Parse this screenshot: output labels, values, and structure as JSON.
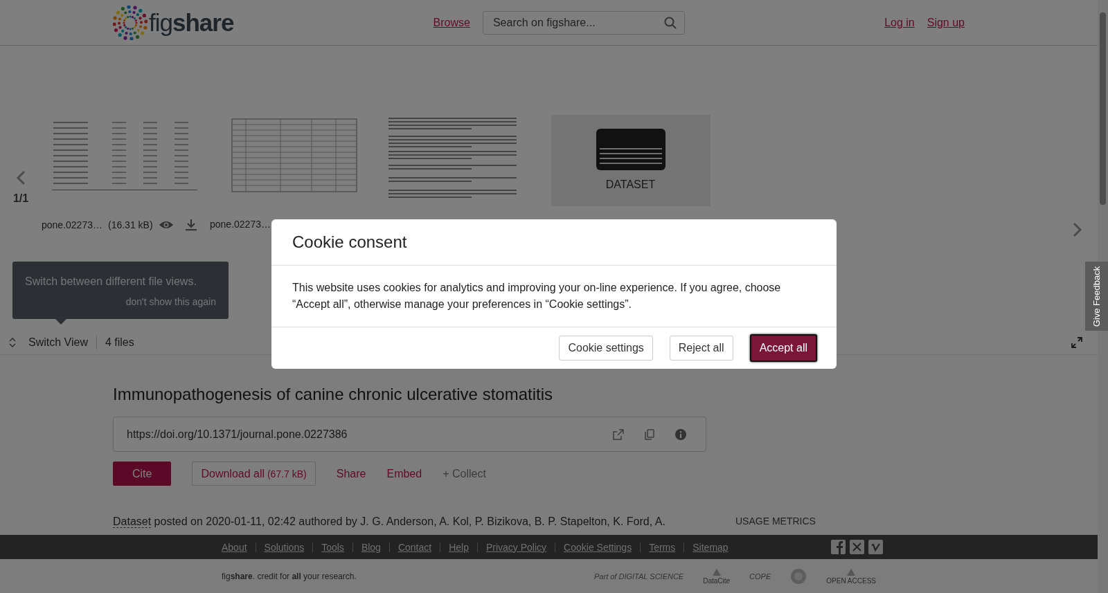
{
  "header": {
    "logo": "fig**share**",
    "nav_link": "Browse",
    "search": {
      "placeholder": "Search on figshare..."
    },
    "account_links": [
      "Log in",
      "Sign up"
    ]
  },
  "carousel": {
    "page_indicator": "1/1",
    "thumbnails": [
      {
        "kind": "table_doc"
      },
      {
        "kind": "table_grid"
      },
      {
        "kind": "text_doc"
      },
      {
        "kind": "dataset",
        "label": "DATASET"
      }
    ],
    "files": [
      {
        "name": "pone.02273…",
        "size": "(16.31 kB)"
      },
      {
        "name": "pone.02273…"
      }
    ]
  },
  "tooltip": {
    "text": "Switch between different file views.",
    "dismiss": "don't show this again"
  },
  "toolbar": {
    "switch_view": "Switch View",
    "file_count": "4 files"
  },
  "feedback_tab": "Give Feedback",
  "item": {
    "title": "Immunopathogenesis of canine chronic ulcerative stomatitis",
    "doi": "https://doi.org/10.1371/journal.pone.0227386",
    "actions": [
      {
        "kind": "primary",
        "label": "Cite"
      },
      {
        "kind": "outline",
        "label": "Download all",
        "size": "(67.7 kB)"
      },
      {
        "kind": "link",
        "label": "Share"
      },
      {
        "kind": "link",
        "label": "Embed"
      },
      {
        "kind": "muted",
        "label": "+ Collect"
      }
    ],
    "item_type": "Dataset",
    "meta": " posted on 2020-01-11, 02:42 authored by J. G. Anderson, A. Kol, P. Bizikova, B. P. Stapelton, K. Ford, A.",
    "usage_metrics": "USAGE METRICS"
  },
  "footer": {
    "links": [
      "About",
      "Solutions",
      "Tools",
      "Blog",
      "Contact",
      "Help",
      "Privacy Policy",
      "Cookie Settings",
      "Terms",
      "Sitemap"
    ],
    "tagline": "fig**share**. credit for **all** your research.",
    "partners": [
      {
        "kind": "text",
        "text": "Part of DIGITAL SCIENCE"
      },
      {
        "kind": "mark",
        "text": "DataCite"
      },
      {
        "kind": "text",
        "text": "COPE"
      },
      {
        "kind": "circle"
      },
      {
        "kind": "mark",
        "text": "OPEN ACCESS"
      }
    ]
  },
  "cookie_modal": {
    "title": "Cookie consent",
    "body": "This website uses cookies for analytics and improving your on-line experience. If you agree, choose “Accept all”, otherwise manage your preferences in “Cookie settings”.",
    "buttons": [
      {
        "kind": "secondary",
        "label": "Cookie settings"
      },
      {
        "kind": "secondary",
        "label": "Reject all"
      },
      {
        "kind": "primary",
        "label": "Accept all"
      }
    ]
  }
}
